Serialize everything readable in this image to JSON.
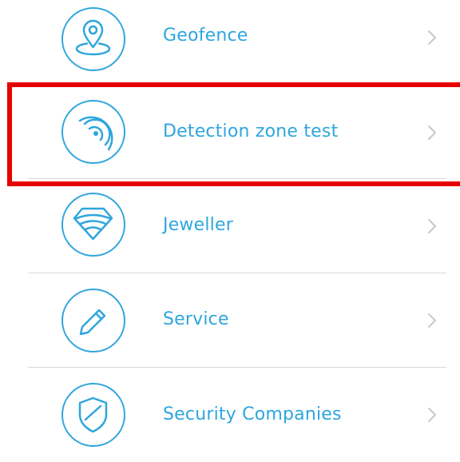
{
  "menu": {
    "items": [
      {
        "label": "Geofence",
        "icon": "location-pin-icon"
      },
      {
        "label": "Detection zone test",
        "icon": "signal-waves-icon"
      },
      {
        "label": "Jeweller",
        "icon": "diamond-wifi-icon"
      },
      {
        "label": "Service",
        "icon": "pencil-icon"
      },
      {
        "label": "Security Companies",
        "icon": "shield-icon"
      }
    ]
  },
  "colors": {
    "accent": "#2ea6dd",
    "highlight": "#e60000",
    "divider": "#d9d9d9",
    "chevron": "#c7c7cc"
  }
}
